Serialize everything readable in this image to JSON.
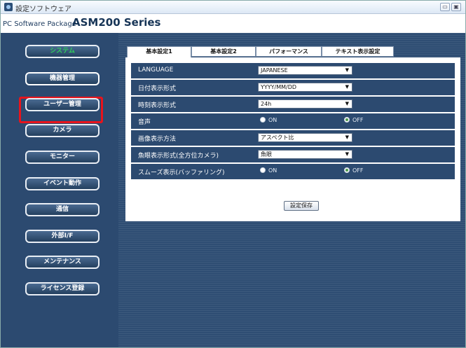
{
  "window": {
    "title": "設定ソフトウェア",
    "controls": {
      "minimize": "▭",
      "maximize": "▣",
      "close": "✕"
    }
  },
  "header": {
    "brand_small": "PC Software Package",
    "brand_big": "ASM200 Series"
  },
  "sidebar": {
    "items": [
      {
        "label": "システム",
        "state": "active"
      },
      {
        "label": "機器管理",
        "state": "selected"
      },
      {
        "label": "ユーザー管理"
      },
      {
        "label": "カメラ"
      },
      {
        "label": "モニター"
      },
      {
        "label": "イベント動作"
      },
      {
        "label": "通信"
      },
      {
        "label": "外部I/F"
      },
      {
        "label": "メンテナンス"
      },
      {
        "label": "ライセンス登録"
      }
    ]
  },
  "tabs": [
    {
      "label": "基本設定1",
      "active": true
    },
    {
      "label": "基本設定2"
    },
    {
      "label": "パフォーマンス"
    },
    {
      "label": "テキスト表示設定"
    }
  ],
  "settings": {
    "language": {
      "label": "LANGUAGE",
      "value": "JAPANESE"
    },
    "date_format": {
      "label": "日付表示形式",
      "value": "YYYY/MM/DD"
    },
    "time_format": {
      "label": "時刻表示形式",
      "value": "24h"
    },
    "sound": {
      "label": "音声",
      "on_label": "ON",
      "off_label": "OFF",
      "selected": "OFF"
    },
    "image_display": {
      "label": "画像表示方法",
      "value": "アスペクト比"
    },
    "fisheye_display": {
      "label": "魚眼表示形式(全方位カメラ)",
      "value": "魚眼"
    },
    "smooth_display": {
      "label": "スムーズ表示(バッファリング)",
      "on_label": "ON",
      "off_label": "OFF",
      "selected": "OFF"
    }
  },
  "save_label": "設定保存",
  "colors": {
    "sidebar_bg": "#2c4a70",
    "active_text": "#2fd05a",
    "highlight": "#e8141c"
  }
}
